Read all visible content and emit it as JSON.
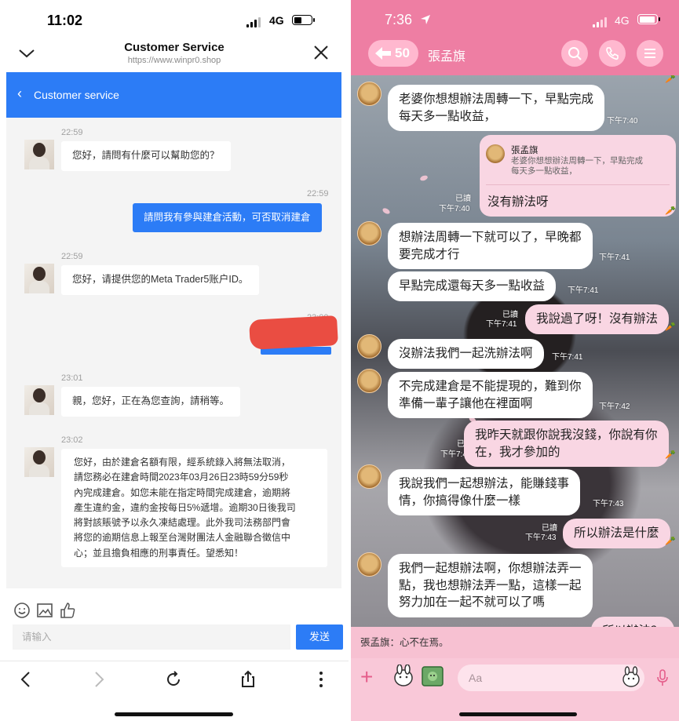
{
  "left": {
    "status": {
      "time": "11:02",
      "network": "4G"
    },
    "header": {
      "title": "Customer Service",
      "url": "https://www.winpr0.shop"
    },
    "bar": {
      "title": "Customer service"
    },
    "messages": [
      {
        "time": "22:59",
        "text": "您好，請問有什麼可以幫助您的？"
      },
      {
        "time": "22:59",
        "text": "請問我有參與建倉活動，可否取消建倉"
      },
      {
        "time": "22:59",
        "text": "您好，请提供您的Meta Trader5账户ID。"
      },
      {
        "time": "23:00",
        "text": ""
      },
      {
        "time": "23:01",
        "text": "親，您好，正在為您查詢，請稍等。"
      },
      {
        "time": "23:02",
        "lines": [
          "您好，由於建倉名額有限，經系統錄入將無法取消，",
          "請您務必在建倉時間2023年03月26日23時59分59秒",
          "內完成建倉。如您未能在指定時間完成建倉，逾期將",
          "產生違約金，違約金按每日5%遞增。逾期30日後我司",
          "將對該賬號予以永久凍結處理。此外我司法務部門會",
          "將您的逾期信息上報至台灣財團法人金融聯合徵信中",
          "心；並且擔負相應的刑事責任。望悉知！"
        ]
      }
    ],
    "input": {
      "placeholder": "请输入",
      "send": "发送"
    },
    "icons": {
      "toolbar": [
        "emoji-icon",
        "image-icon",
        "thumbs-up-icon"
      ],
      "browser": [
        "back-icon",
        "forward-icon",
        "reload-icon",
        "share-icon",
        "more-icon"
      ]
    }
  },
  "right": {
    "status": {
      "time": "7:36",
      "network": "4G"
    },
    "nav": {
      "back_count": "50",
      "name": "張孟旗"
    },
    "messages": [
      {
        "text": "老婆你想想辦法周轉一下，早點完成\n每天多一點收益，",
        "time": "下午7:40"
      },
      {
        "reply_name": "張孟旗",
        "reply_quote": "老婆你想想辦法周轉一下，早點完成\n每天多一點收益，",
        "text": "沒有辦法呀",
        "read": "已讀",
        "time": "下午7:40"
      },
      {
        "text": "想辦法周轉一下就可以了，早晚都\n要完成才行",
        "time": "下午7:41"
      },
      {
        "text": "早點完成還每天多一點收益",
        "time": "下午7:41"
      },
      {
        "text": "我說過了呀！沒有辦法",
        "read": "已讀",
        "time": "下午7:41"
      },
      {
        "text": "沒辦法我們一起洗辦法啊",
        "time": "下午7:41"
      },
      {
        "text": "不完成建倉是不能提現的，難到你\n準備一輩子讓他在裡面啊",
        "time": "下午7:42"
      },
      {
        "text": "我昨天就跟你說我沒錢，你說有你\n在，我才參加的",
        "read": "已讀",
        "time": "下午7:42"
      },
      {
        "text": "我說我們一起想辦法，能賺錢事\n情，你搞得像什麼一樣",
        "time": "下午7:43"
      },
      {
        "text": "所以辦法是什麼",
        "read": "已讀",
        "time": "下午7:43"
      },
      {
        "text": "我們一起想辦法啊，你想辦法弄一\n點，我也想辦法弄一點，這樣一起\n努力加在一起不就可以了嗎",
        "time": ""
      },
      {
        "text": "所以辦法？",
        "time": ""
      }
    ],
    "notice": "張孟旗：心不在焉。",
    "input": {
      "placeholder": "Aa"
    },
    "colors": {
      "header": "#ee7ea3",
      "my_bubble": "#f9d6e3"
    }
  }
}
